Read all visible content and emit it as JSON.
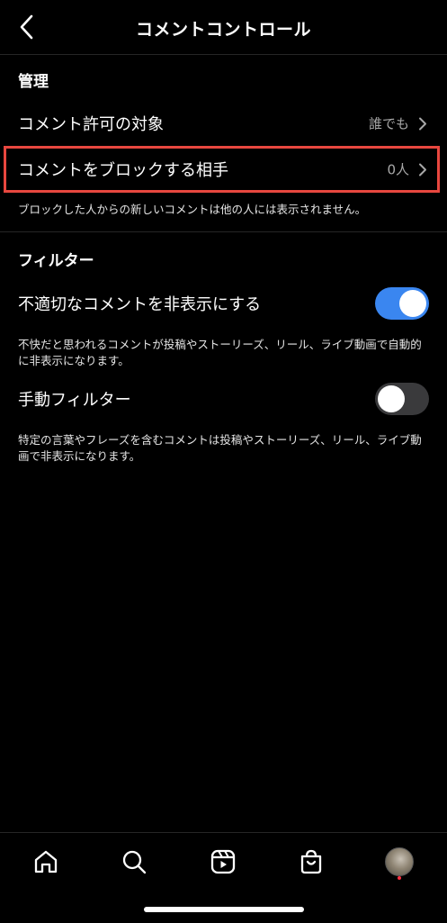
{
  "header": {
    "title": "コメントコントロール",
    "back_icon": "chevron-left-icon"
  },
  "management": {
    "section_title": "管理",
    "allow_from": {
      "label": "コメント許可の対象",
      "value": "誰でも"
    },
    "block_from": {
      "label": "コメントをブロックする相手",
      "value": "0人"
    },
    "block_desc": "ブロックした人からの新しいコメントは他の人には表示されません。"
  },
  "filters": {
    "section_title": "フィルター",
    "hide_offensive": {
      "label": "不適切なコメントを非表示にする",
      "enabled": true,
      "desc": "不快だと思われるコメントが投稿やストーリーズ、リール、ライブ動画で自動的に非表示になります。"
    },
    "manual_filter": {
      "label": "手動フィルター",
      "enabled": false,
      "desc": "特定の言葉やフレーズを含むコメントは投稿やストーリーズ、リール、ライブ動画で非表示になります。"
    }
  },
  "tabbar": {
    "items": [
      "home-icon",
      "search-icon",
      "reels-icon",
      "shop-icon",
      "profile-avatar"
    ]
  },
  "colors": {
    "toggle_on": "#3a86f0",
    "highlight": "#e8473f",
    "notification": "#ff3040"
  }
}
